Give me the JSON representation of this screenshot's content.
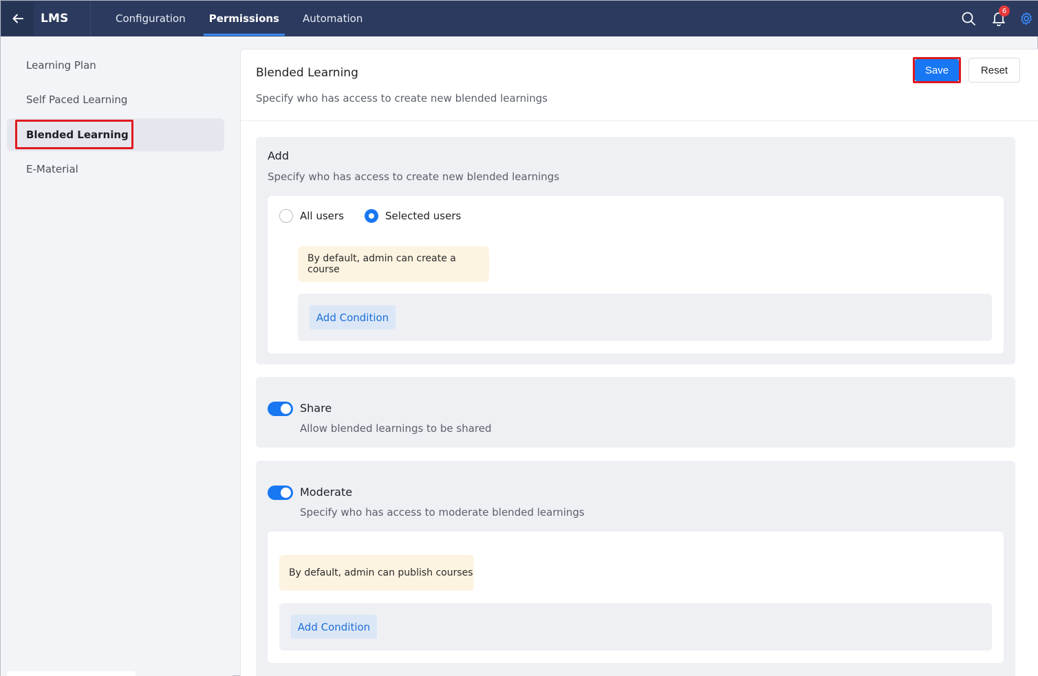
{
  "app": {
    "title": "LMS"
  },
  "nav": {
    "tabs": [
      {
        "label": "Configuration"
      },
      {
        "label": "Permissions"
      },
      {
        "label": "Automation"
      }
    ],
    "active": "Permissions"
  },
  "header": {
    "notification_count": "6"
  },
  "sidebar": {
    "items": [
      {
        "label": "Learning Plan"
      },
      {
        "label": "Self Paced Learning"
      },
      {
        "label": "Blended Learning"
      },
      {
        "label": "E-Material"
      }
    ],
    "active": "Blended Learning"
  },
  "panel": {
    "title": "Blended Learning",
    "subtitle": "Specify who has access to create new blended learnings",
    "save_label": "Save",
    "reset_label": "Reset"
  },
  "add_section": {
    "title": "Add",
    "subtitle": "Specify who has access to create new blended learnings",
    "options": [
      {
        "label": "All users",
        "checked": false
      },
      {
        "label": "Selected users",
        "checked": true
      }
    ],
    "note": "By default, admin can create a course",
    "add_condition_label": "Add Condition"
  },
  "share_section": {
    "title": "Share",
    "subtitle": "Allow blended learnings to be shared",
    "enabled": true
  },
  "moderate_section": {
    "title": "Moderate",
    "subtitle": "Specify who has access to moderate blended learnings",
    "enabled": true,
    "note": "By default, admin can publish courses",
    "add_condition_label": "Add Condition"
  },
  "colors": {
    "topbar": "#2b3a5e",
    "accent": "#1877f2",
    "highlight": "#e0191e",
    "note_bg": "#fdf3e1"
  }
}
